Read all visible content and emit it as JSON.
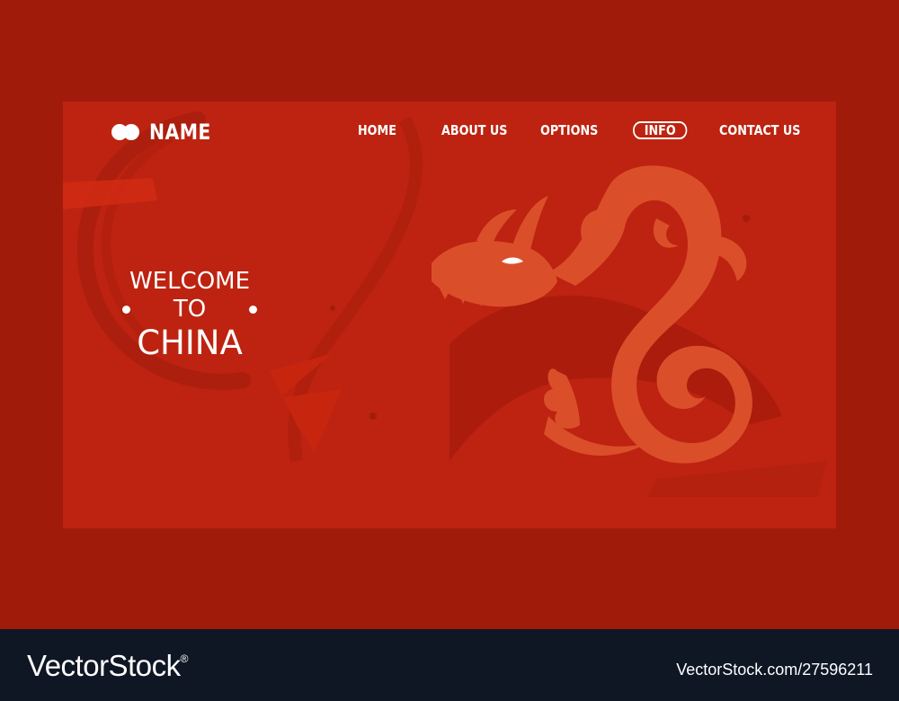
{
  "brand": {
    "name": "NAME",
    "icon": "double-circle-logo-icon"
  },
  "nav": {
    "items": [
      {
        "label": "HOME",
        "active": false
      },
      {
        "label": "ABOUT US",
        "active": false
      },
      {
        "label": "OPTIONS",
        "active": false
      },
      {
        "label": "INFO",
        "active": true
      },
      {
        "label": "CONTACT US",
        "active": false
      }
    ]
  },
  "hero": {
    "line1": "WELCOME",
    "line2": "TO",
    "line3": "CHINA",
    "illustration": "dragon-icon"
  },
  "footer": {
    "logo": "VectorStock",
    "registered": "®",
    "image_id": "VectorStock.com/27596211"
  },
  "colors": {
    "outer_background": "#a11b0b",
    "card_background": "#bd2310",
    "dragon": "#db4e2a",
    "footer_background": "#0f1725",
    "text": "#ffffff"
  }
}
